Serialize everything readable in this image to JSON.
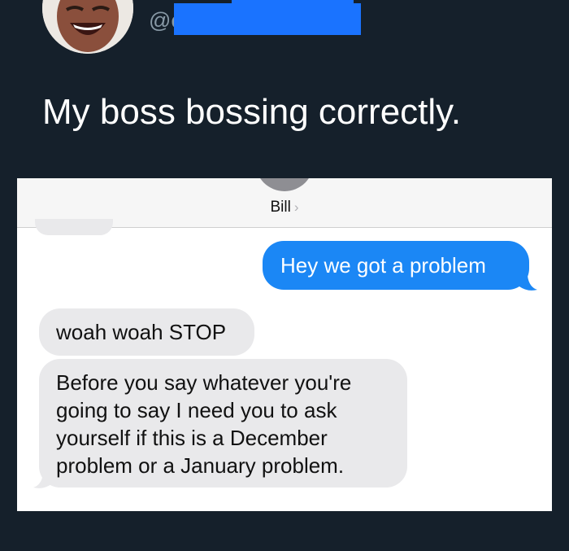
{
  "tweet": {
    "handle_visible": "@e",
    "text": "My boss bossing correctly."
  },
  "conversation": {
    "contact_name": "Bill",
    "contact_chevron": "›",
    "messages": [
      {
        "direction": "outgoing",
        "text": "Hey we got a problem"
      },
      {
        "direction": "incoming",
        "text": "woah woah STOP"
      },
      {
        "direction": "incoming",
        "text": "Before you say whatever you're going to say I need you to ask yourself if this is a December problem or a January problem."
      }
    ]
  },
  "colors": {
    "background": "#15202b",
    "outgoing_bubble": "#1b87f5",
    "incoming_bubble": "#e9e9eb",
    "redaction": "#1a73ff"
  },
  "icons": {
    "chevron": "chevron-right-icon"
  }
}
